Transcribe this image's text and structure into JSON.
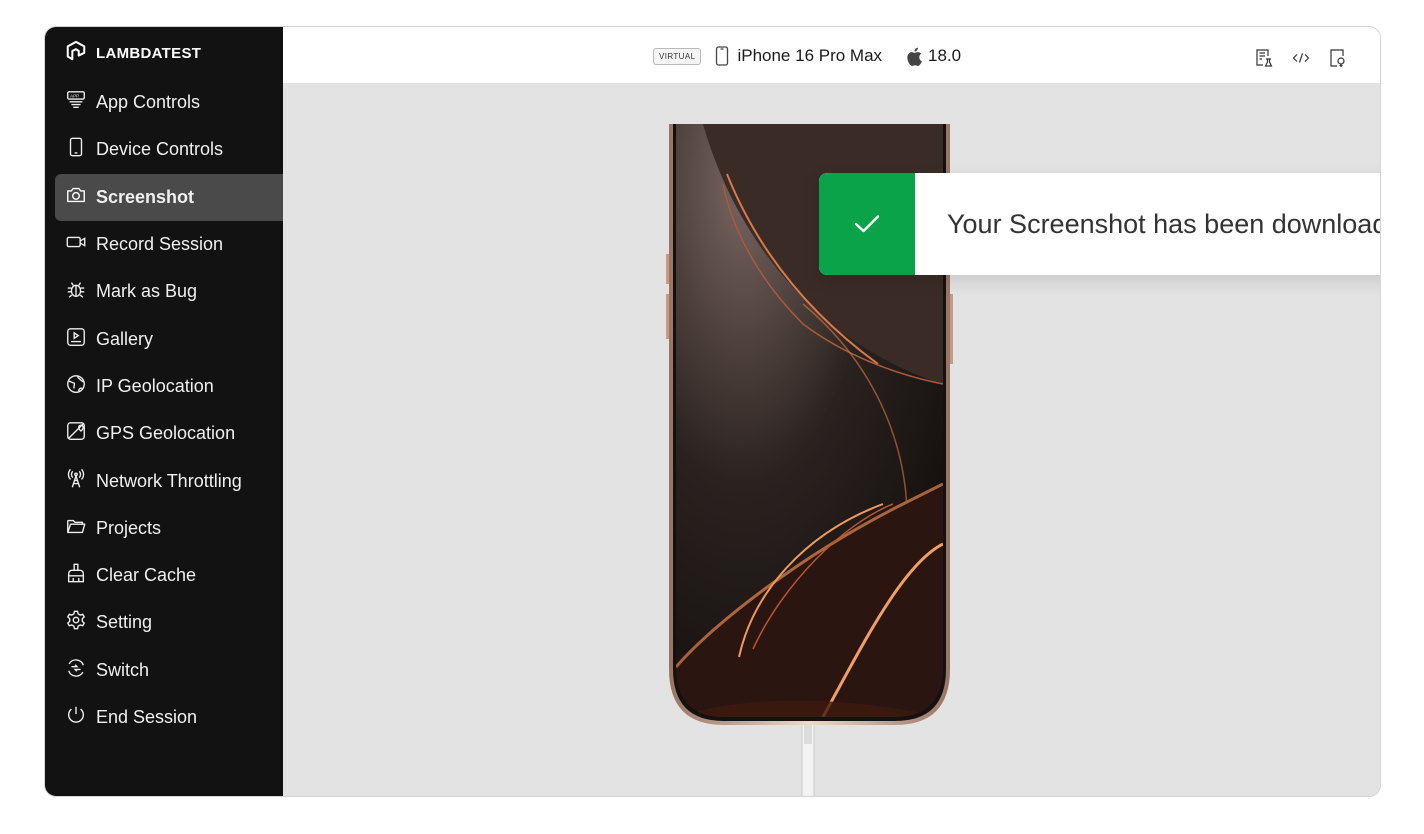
{
  "brand": {
    "name": "LAMBDATEST",
    "logo_icon": "lambdatest-logo-icon"
  },
  "sidebar": {
    "items": [
      {
        "label": "App Controls",
        "icon": "app-icon",
        "active": false
      },
      {
        "label": "Device Controls",
        "icon": "phone-icon",
        "active": false
      },
      {
        "label": "Screenshot",
        "icon": "camera-icon",
        "active": true
      },
      {
        "label": "Record Session",
        "icon": "video-icon",
        "active": false
      },
      {
        "label": "Mark as Bug",
        "icon": "bug-icon",
        "active": false
      },
      {
        "label": "Gallery",
        "icon": "gallery-icon",
        "active": false
      },
      {
        "label": "IP Geolocation",
        "icon": "globe-icon",
        "active": false
      },
      {
        "label": "GPS Geolocation",
        "icon": "map-icon",
        "active": false
      },
      {
        "label": "Network Throttling",
        "icon": "antenna-icon",
        "active": false
      },
      {
        "label": "Projects",
        "icon": "folder-icon",
        "active": false
      },
      {
        "label": "Clear Cache",
        "icon": "broom-icon",
        "active": false
      },
      {
        "label": "Setting",
        "icon": "gear-icon",
        "active": false
      },
      {
        "label": "Switch",
        "icon": "switch-icon",
        "active": false
      },
      {
        "label": "End Session",
        "icon": "power-icon",
        "active": false
      }
    ]
  },
  "topbar": {
    "badge": "VIRTUAL",
    "device_name": "iPhone 16 Pro Max",
    "os_version": "18.0",
    "actions": [
      "test-report-icon",
      "code-icon",
      "inspector-icon"
    ]
  },
  "toast": {
    "message": "Your Screenshot has been downloaded",
    "status_color": "#0ba34a",
    "icon": "checkmark-icon",
    "close_icon": "close-icon"
  },
  "colors": {
    "sidebar_bg": "#121212",
    "active_bg": "#4a4a4a",
    "canvas_bg": "#e3e3e3"
  }
}
